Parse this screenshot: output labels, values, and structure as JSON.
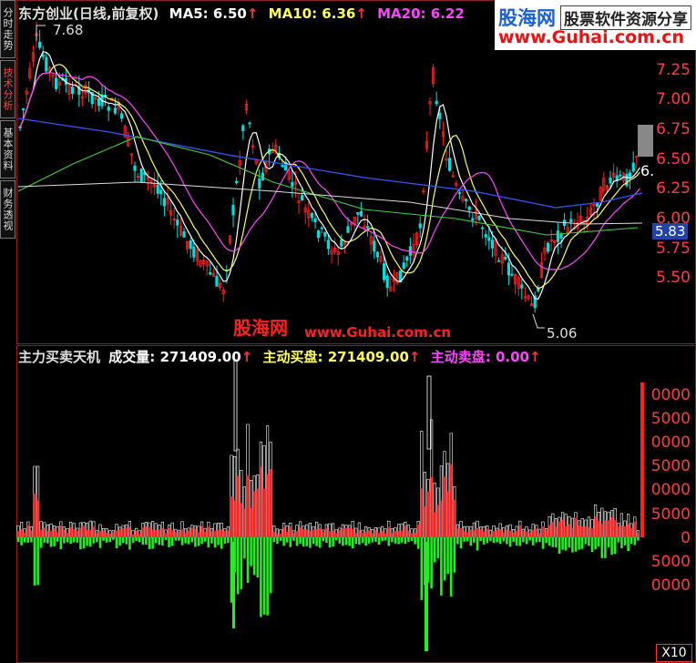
{
  "side_tabs": [
    {
      "label": "分时走势",
      "active": false
    },
    {
      "label": "技术分析",
      "active": true
    },
    {
      "label": "基本资料",
      "active": false
    },
    {
      "label": "财务透视",
      "active": false
    }
  ],
  "main_header": {
    "title": "东方创业(日线,前复权)",
    "ma5": "MA5: 6.50",
    "ma10": "MA10: 6.36",
    "ma20": "MA20: 6.22"
  },
  "price_axis": [
    "7.25",
    "7.00",
    "6.75",
    "6.50",
    "6.25",
    "6.00",
    "5.75",
    "5.50"
  ],
  "price_marks": {
    "high": "7.68",
    "low": "5.06",
    "last": "5.83",
    "current": "6."
  },
  "volume_header": {
    "name": "主力买卖天机",
    "vol": "成交量: 271409.00",
    "buy": "主动买盘: 271409.00",
    "sell": "主动卖盘: 0.00"
  },
  "volume_axis": [
    "0000",
    "5000",
    "0000",
    "5000",
    "0000",
    "5000",
    "0",
    "5000",
    "0000"
  ],
  "volume_unit": "X10",
  "watermark": {
    "cn": "股海网",
    "url": "www.Guhai.com.cn"
  },
  "logo": {
    "brand": "股海网",
    "slogan": "股票软件资源分享",
    "url": "www.Guhai.com.cn"
  },
  "colors": {
    "ma5": "#ffffff",
    "ma10": "#ffff55",
    "ma20": "#ff44ff",
    "up": "#ff2020",
    "down": "#22ee22",
    "long": "#3355ff"
  }
}
